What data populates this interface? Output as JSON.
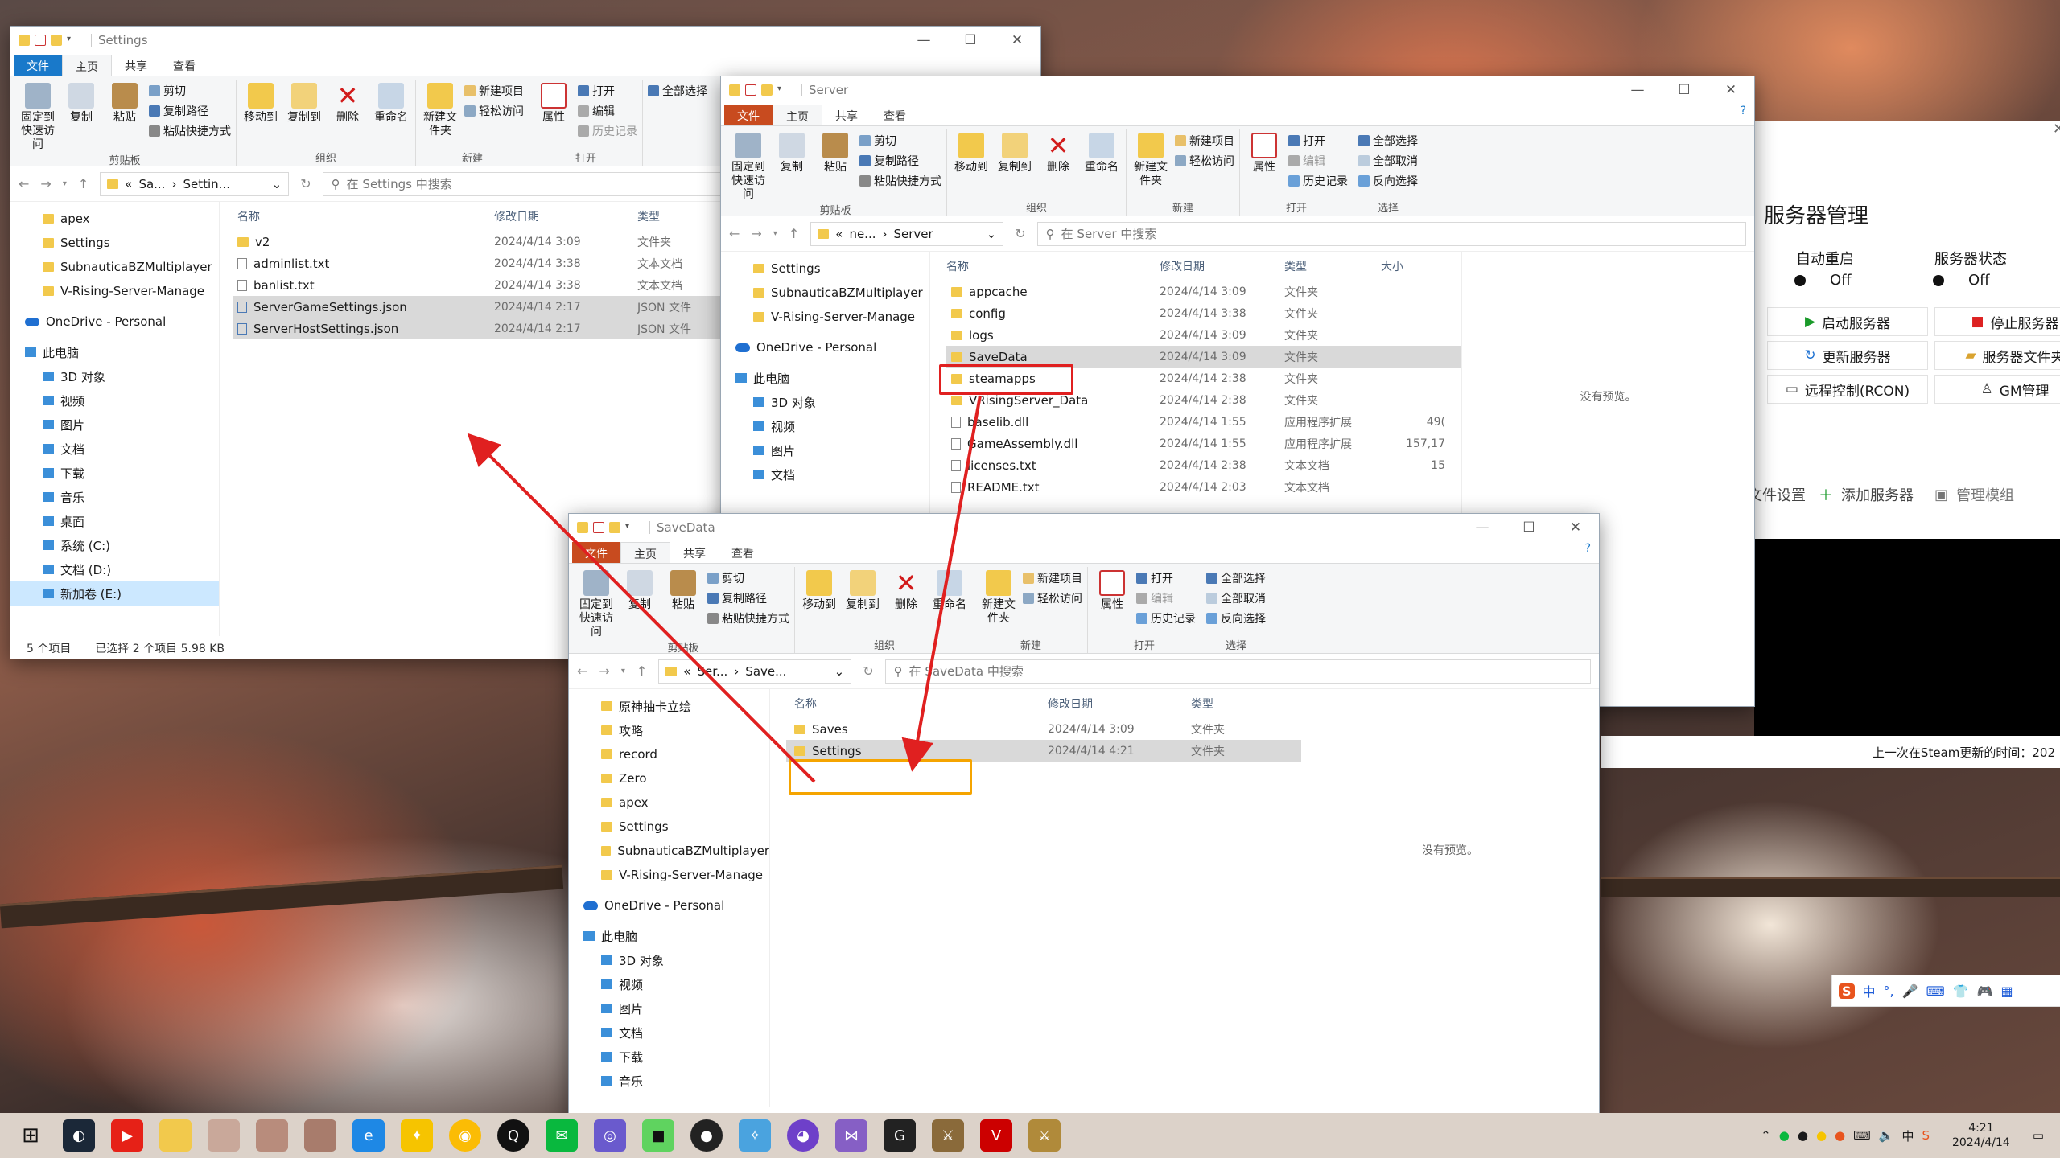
{
  "win1": {
    "title": "Settings",
    "tabs": [
      "文件",
      "主页",
      "共享",
      "查看"
    ],
    "ribbon": {
      "pin": "固定到快速访问",
      "copy": "复制",
      "paste": "粘贴",
      "cut": "剪切",
      "copy_path": "复制路径",
      "paste_shortcut": "粘贴快捷方式",
      "clipboard": "剪贴板",
      "move_to": "移动到",
      "copy_to": "复制到",
      "delete": "删除",
      "rename": "重命名",
      "organize": "组织",
      "new_folder": "新建文件夹",
      "new_item": "新建项目",
      "easy_access": "轻松访问",
      "new": "新建",
      "properties": "属性",
      "open": "打开",
      "edit": "编辑",
      "history": "历史记录",
      "open_group": "打开",
      "select_all": "全部选择"
    },
    "path": [
      "«",
      "Sa...",
      "Settin..."
    ],
    "search_placeholder": "在 Settings 中搜索",
    "nav": [
      "apex",
      "Settings",
      "SubnauticaBZMultiplayer",
      "V-Rising-Server-Manage",
      "OneDrive - Personal",
      "此电脑",
      "3D 对象",
      "视频",
      "图片",
      "文档",
      "下载",
      "音乐",
      "桌面",
      "系统 (C:)",
      "文档 (D:)",
      "新加卷 (E:)"
    ],
    "columns": [
      "名称",
      "修改日期",
      "类型"
    ],
    "files": [
      {
        "name": "v2",
        "date": "2024/4/14 3:09",
        "type": "文件夹",
        "sel": false
      },
      {
        "name": "adminlist.txt",
        "date": "2024/4/14 3:38",
        "type": "文本文档",
        "sel": false
      },
      {
        "name": "banlist.txt",
        "date": "2024/4/14 3:38",
        "type": "文本文档",
        "sel": false
      },
      {
        "name": "ServerGameSettings.json",
        "date": "2024/4/14 2:17",
        "type": "JSON 文件",
        "sel": true
      },
      {
        "name": "ServerHostSettings.json",
        "date": "2024/4/14 2:17",
        "type": "JSON 文件",
        "sel": true
      }
    ],
    "status": {
      "count": "5 个项目",
      "selected": "已选择 2 个项目  5.98 KB"
    }
  },
  "win2": {
    "title": "Server",
    "tabs": [
      "文件",
      "主页",
      "共享",
      "查看"
    ],
    "ribbon": {
      "pin": "固定到快速访问",
      "copy": "复制",
      "paste": "粘贴",
      "cut": "剪切",
      "copy_path": "复制路径",
      "paste_shortcut": "粘贴快捷方式",
      "clipboard": "剪贴板",
      "move_to": "移动到",
      "copy_to": "复制到",
      "delete": "删除",
      "rename": "重命名",
      "organize": "组织",
      "new_folder": "新建文件夹",
      "new_item": "新建项目",
      "easy_access": "轻松访问",
      "new": "新建",
      "properties": "属性",
      "open": "打开",
      "edit": "编辑",
      "history": "历史记录",
      "open_group": "打开",
      "select_all": "全部选择",
      "select_none": "全部取消",
      "invert": "反向选择",
      "select": "选择"
    },
    "path": [
      "«",
      "ne...",
      "Server"
    ],
    "search_placeholder": "在 Server 中搜索",
    "nav": [
      "Settings",
      "SubnauticaBZMultiplayer",
      "V-Rising-Server-Manage",
      "OneDrive - Personal",
      "此电脑",
      "3D 对象",
      "视频",
      "图片",
      "文档"
    ],
    "columns": [
      "名称",
      "修改日期",
      "类型",
      "大小"
    ],
    "files": [
      {
        "name": "appcache",
        "date": "2024/4/14 3:09",
        "type": "文件夹",
        "size": ""
      },
      {
        "name": "config",
        "date": "2024/4/14 3:38",
        "type": "文件夹",
        "size": ""
      },
      {
        "name": "logs",
        "date": "2024/4/14 3:09",
        "type": "文件夹",
        "size": ""
      },
      {
        "name": "SaveData",
        "date": "2024/4/14 3:09",
        "type": "文件夹",
        "size": ""
      },
      {
        "name": "steamapps",
        "date": "2024/4/14 2:38",
        "type": "文件夹",
        "size": ""
      },
      {
        "name": "VRisingServer_Data",
        "date": "2024/4/14 2:38",
        "type": "文件夹",
        "size": ""
      },
      {
        "name": "baselib.dll",
        "date": "2024/4/14 1:55",
        "type": "应用程序扩展",
        "size": "49("
      },
      {
        "name": "GameAssembly.dll",
        "date": "2024/4/14 1:55",
        "type": "应用程序扩展",
        "size": "157,17"
      },
      {
        "name": "licenses.txt",
        "date": "2024/4/14 2:38",
        "type": "文本文档",
        "size": "15"
      },
      {
        "name": "README.txt",
        "date": "2024/4/14 2:03",
        "type": "文本文档",
        "size": ""
      }
    ],
    "no_preview": "没有预览。"
  },
  "win3": {
    "title": "SaveData",
    "tabs": [
      "文件",
      "主页",
      "共享",
      "查看"
    ],
    "ribbon": {
      "pin": "固定到快速访问",
      "copy": "复制",
      "paste": "粘贴",
      "cut": "剪切",
      "copy_path": "复制路径",
      "paste_shortcut": "粘贴快捷方式",
      "clipboard": "剪贴板",
      "move_to": "移动到",
      "copy_to": "复制到",
      "delete": "删除",
      "rename": "重命名",
      "organize": "组织",
      "new_folder": "新建文件夹",
      "new_item": "新建项目",
      "easy_access": "轻松访问",
      "new": "新建",
      "properties": "属性",
      "open": "打开",
      "edit": "编辑",
      "history": "历史记录",
      "open_group": "打开",
      "select_all": "全部选择",
      "select_none": "全部取消",
      "invert": "反向选择",
      "select": "选择"
    },
    "path": [
      "«",
      "Ser...",
      "Save..."
    ],
    "search_placeholder": "在 SaveData 中搜索",
    "nav": [
      "原神抽卡立绘",
      "攻略",
      "record",
      "Zero",
      "apex",
      "Settings",
      "SubnauticaBZMultiplayer",
      "V-Rising-Server-Manage",
      "OneDrive - Personal",
      "此电脑",
      "3D 对象",
      "视频",
      "图片",
      "文档",
      "下载",
      "音乐"
    ],
    "columns": [
      "名称",
      "修改日期",
      "类型"
    ],
    "files": [
      {
        "name": "Saves",
        "date": "2024/4/14 3:09",
        "type": "文件夹"
      },
      {
        "name": "Settings",
        "date": "2024/4/14 4:21",
        "type": "文件夹"
      }
    ],
    "no_preview": "没有预览。"
  },
  "server_app": {
    "title": "服务器管理",
    "auto_restart": "自动重启",
    "server_status": "服务器状态",
    "off": "Off",
    "start": "启动服务器",
    "stop": "停止服务器",
    "update": "更新服务器",
    "folder": "服务器文件夹",
    "rcon": "远程控制(RCON)",
    "gm": "GM管理",
    "file_settings": "文件设置",
    "add_server": "添加服务器",
    "mods": "管理模组",
    "steam_update": "上一次在Steam更新的时间：202"
  },
  "taskbar": {
    "time": "4:21",
    "date": "2024/4/14",
    "ime": "中"
  },
  "colors": {
    "accent": "#1979ca",
    "red_box": "#e02020",
    "orange_box": "#f5a400",
    "arrow": "#e02020"
  }
}
